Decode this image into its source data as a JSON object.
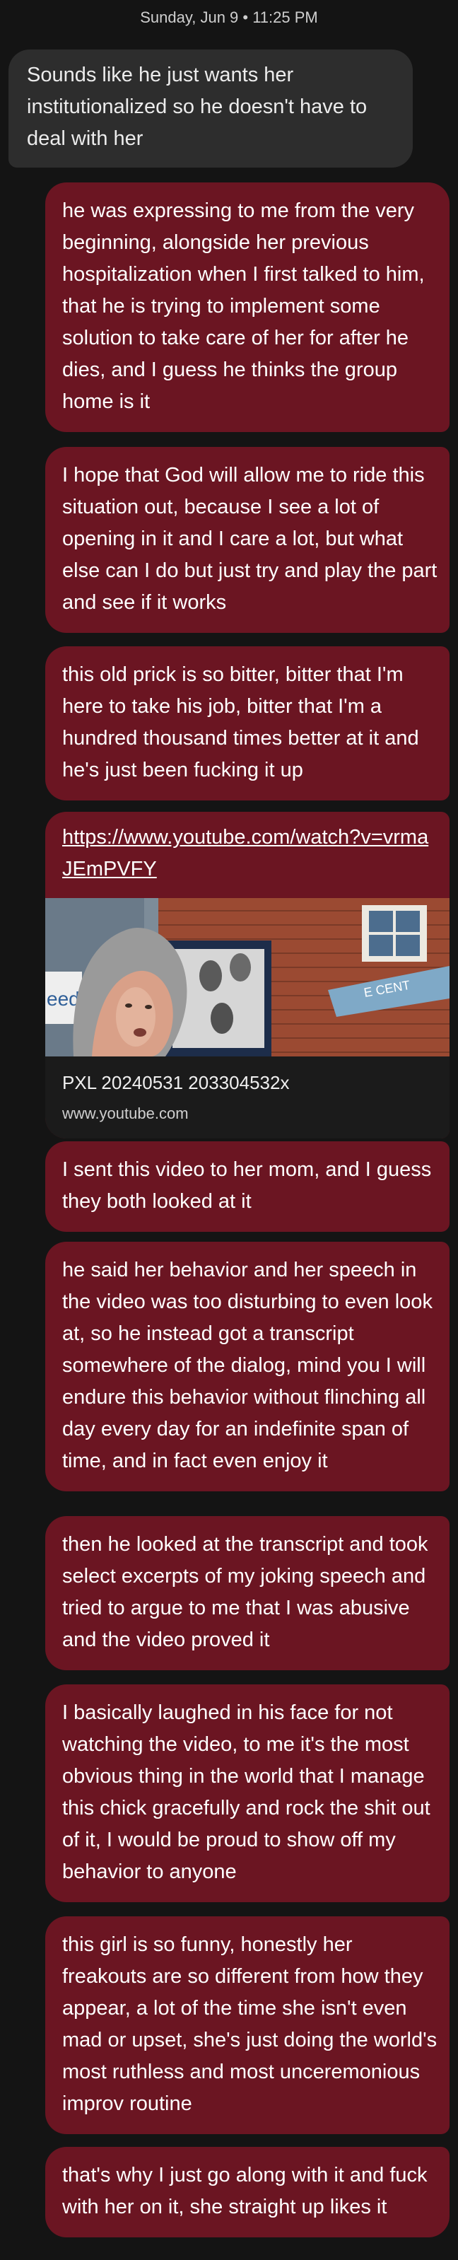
{
  "header": {
    "date": "Sunday, Jun 9 • 11:25 PM"
  },
  "messages": [
    {
      "direction": "incoming",
      "text": "Sounds like he just wants her institutionalized so he doesn't have to deal with her"
    },
    {
      "direction": "outgoing",
      "text": "he was expressing to me from the very beginning, alongside her previous hospitalization when I first talked to him, that he is trying to implement some solution to take care of her for after he dies, and I guess he thinks the group home is it"
    },
    {
      "direction": "outgoing",
      "text": "I hope that God will allow me to ride this situation out, because I see a lot of opening in it and I care a lot, but what else can I do but just try and play the part and see if it works"
    },
    {
      "direction": "outgoing",
      "text": "this old prick is so bitter, bitter that I'm here to take his job, bitter that I'm a hundred thousand times better at it and he's just been fucking it up"
    },
    {
      "direction": "outgoing",
      "text": "I sent this video to her mom, and I guess they both looked at it"
    },
    {
      "direction": "outgoing",
      "text": "he said her behavior and her speech in the video was too disturbing to even look at, so he instead got a transcript somewhere of the dialog, mind you I will endure this behavior without flinching all day every day for an indefinite span of time, and in fact even enjoy it"
    },
    {
      "direction": "outgoing",
      "text": "then he looked at the transcript and took select excerpts of my joking speech and tried to argue to me that I was abusive and the video proved it"
    },
    {
      "direction": "outgoing",
      "text": "I basically laughed in his face for not watching the video, to me it's the most obvious thing in the world that I manage this chick gracefully and rock the shit out of it, I would be proud to show off my behavior to anyone"
    },
    {
      "direction": "outgoing",
      "text": "this girl is so funny, honestly her freakouts are so different from how they appear, a lot of the time she isn't even mad or upset, she's just doing the world's most ruthless and most unceremonious improv routine"
    },
    {
      "direction": "outgoing",
      "text": "that's why I just go along with it and fuck with her on it, she straight up likes it"
    }
  ],
  "link_preview": {
    "url": "https://www.youtube.com/watch?v=vrmaJEmPVFY",
    "title": "PXL 20240531 203304532x",
    "domain": "www.youtube.com",
    "thumbnail_sign_text": "E CENT",
    "thumbnail_banner_text": "eed"
  },
  "colors": {
    "background": "#141414",
    "incoming_bubble": "#2d2d2d",
    "outgoing_bubble": "#6b1522",
    "link_meta_background": "#1b1b1b"
  }
}
